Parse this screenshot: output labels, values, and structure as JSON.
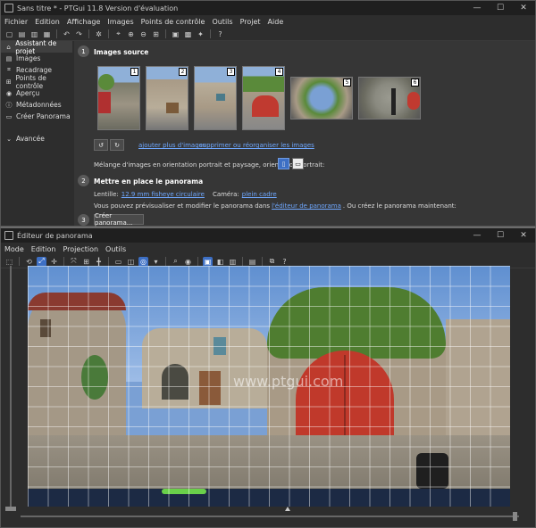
{
  "main_window": {
    "title": "Sans titre * - PTGui 11.8 Version d'évaluation",
    "controls": [
      "—",
      "☐",
      "✕"
    ],
    "menu": [
      "Fichier",
      "Edition",
      "Affichage",
      "Images",
      "Points de contrôle",
      "Outils",
      "Projet",
      "Aide"
    ],
    "sidebar": [
      {
        "label": "Assistant de projet",
        "icon": "wizard-icon"
      },
      {
        "label": "Images",
        "icon": "images-icon"
      },
      {
        "label": "Recadrage",
        "icon": "crop-icon"
      },
      {
        "label": "Points de contrôle",
        "icon": "control-points-icon"
      },
      {
        "label": "Aperçu",
        "icon": "eye-icon"
      },
      {
        "label": "Métadonnées",
        "icon": "info-icon"
      },
      {
        "label": "Créer Panorama",
        "icon": "create-icon"
      },
      {
        "label": "Avancée",
        "icon": "chevron-down-icon"
      }
    ],
    "step1": {
      "number": "1",
      "title": "Images source"
    },
    "thumbnails": [
      "1",
      "2",
      "3",
      "4",
      "5",
      "6"
    ],
    "add_images_link": "ajouter plus d'images",
    "remove_images_link": "supprimer ou réorganiser les images",
    "mix_orientation_text": "Mélange d'images en orientation portrait et paysage, orientation portrait:",
    "step2": {
      "number": "2",
      "title": "Mettre en place le panorama"
    },
    "lens_label": "Lentille:",
    "lens_value": "12.9 mm fisheye circulaire",
    "camera_label": "Caméra:",
    "camera_value": "plein cadre",
    "preview_text_1": "Vous pouvez prévisualiser et modifier le panorama dans",
    "preview_link": "l'éditeur de panorama",
    "preview_text_2": ". Ou créez le panorama maintenant:",
    "step3": {
      "number": "3"
    },
    "create_button": "Créer panorama..."
  },
  "editor_window": {
    "title": "Éditeur de panorama",
    "controls": [
      "—",
      "☐",
      "✕"
    ],
    "menu": [
      "Mode",
      "Edition",
      "Projection",
      "Outils"
    ],
    "watermark": "www.ptgui.com"
  },
  "colors": {
    "accent": "#3d6fc4",
    "link": "#6fa8ff",
    "door": "#c0392b"
  }
}
